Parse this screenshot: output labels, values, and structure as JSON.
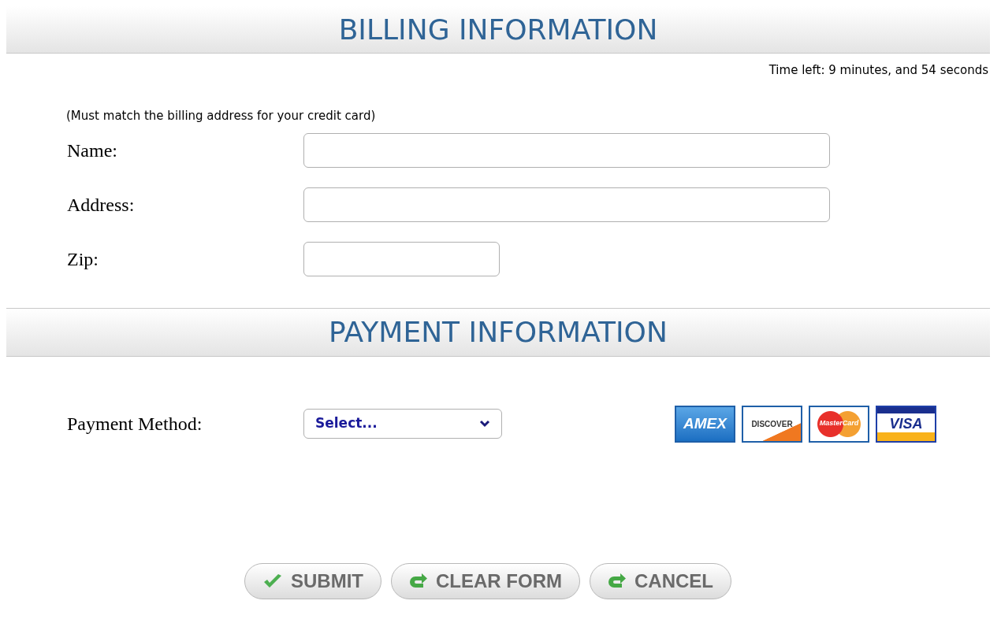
{
  "billing": {
    "title": "BILLING INFORMATION",
    "timer": "Time left: 9 minutes, and 54 seconds",
    "note": "(Must match the billing address for your credit card)",
    "fields": [
      {
        "label": "Name:",
        "kind": "wide"
      },
      {
        "label": "Address:",
        "kind": "wide"
      },
      {
        "label": "Zip:",
        "kind": "short"
      }
    ]
  },
  "payment": {
    "title": "PAYMENT INFORMATION",
    "method_label": "Payment Method:",
    "method_select": "Select...",
    "cards": [
      {
        "label": "AMEX",
        "kind": "amex"
      },
      {
        "label": "DISCOVER",
        "kind": "discover"
      },
      {
        "label": "MasterCard",
        "kind": "mastercard"
      },
      {
        "label": "VISA",
        "kind": "visa"
      }
    ]
  },
  "buttons": [
    {
      "label": "SUBMIT",
      "kind": "check"
    },
    {
      "label": "CLEAR FORM",
      "kind": "reset"
    },
    {
      "label": "CANCEL",
      "kind": "reset"
    }
  ]
}
